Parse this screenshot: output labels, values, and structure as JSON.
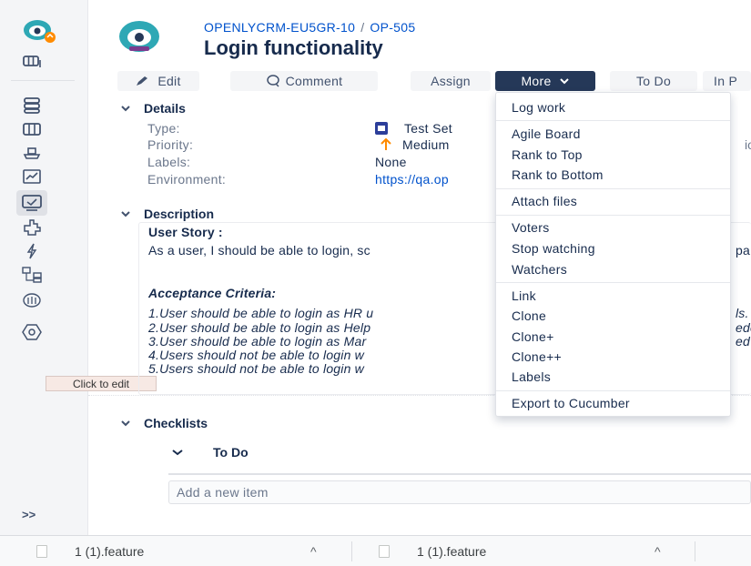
{
  "issue": {
    "project_key": "OPENLYCRM-EU5GR-10",
    "breadcrumb_sep": "/",
    "issue_key": "OP-505",
    "title": "Login functionality"
  },
  "toolbar": {
    "edit": "Edit",
    "comment": "Comment",
    "assign": "Assign",
    "more": "More",
    "todo": "To Do",
    "in_progress": "In P"
  },
  "details": {
    "header": "Details",
    "fields": [
      {
        "label": "Type:",
        "value": "Test Set",
        "icon": "test-set-icon"
      },
      {
        "label": "Priority:",
        "value": "Medium",
        "icon": "arrow-up-icon"
      },
      {
        "label": "Labels:",
        "value": "None"
      },
      {
        "label": "Environment:",
        "value": "https://qa.op"
      }
    ],
    "right_cut": "io"
  },
  "description": {
    "header": "Description",
    "lines": [
      "User Story :",
      "As a user, I should be able to login, sc",
      "Acceptance Criteria:",
      "1.User should be able to login as HR u",
      "2.User should be able to login as Help",
      "3.User should be able to login as Mar",
      "4.Users should not be able to login w",
      "5.Users should not be able to login w"
    ],
    "right_frags": [
      "pa",
      "ls.",
      "ede",
      "ed"
    ]
  },
  "tooltip": "Click to edit",
  "checklists": {
    "header": "Checklists",
    "group": "To Do",
    "add_placeholder": "Add a new item"
  },
  "more_menu": [
    "Log work",
    "Agile Board",
    "Rank to Top",
    "Rank to Bottom",
    "Attach files",
    "Voters",
    "Stop watching",
    "Watchers",
    "Link",
    "Clone",
    "Clone+",
    "Clone++",
    "Labels",
    "Export to Cucumber"
  ],
  "sidebar": {
    "expand": ">>"
  },
  "downloads": [
    {
      "name": "1 (1).feature"
    },
    {
      "name": "1 (1).feature"
    }
  ],
  "colors": {
    "primary_dark": "#253858",
    "link": "#0052cc",
    "priority_medium": "#ff8b00",
    "test_set": "#2c3e9a"
  }
}
